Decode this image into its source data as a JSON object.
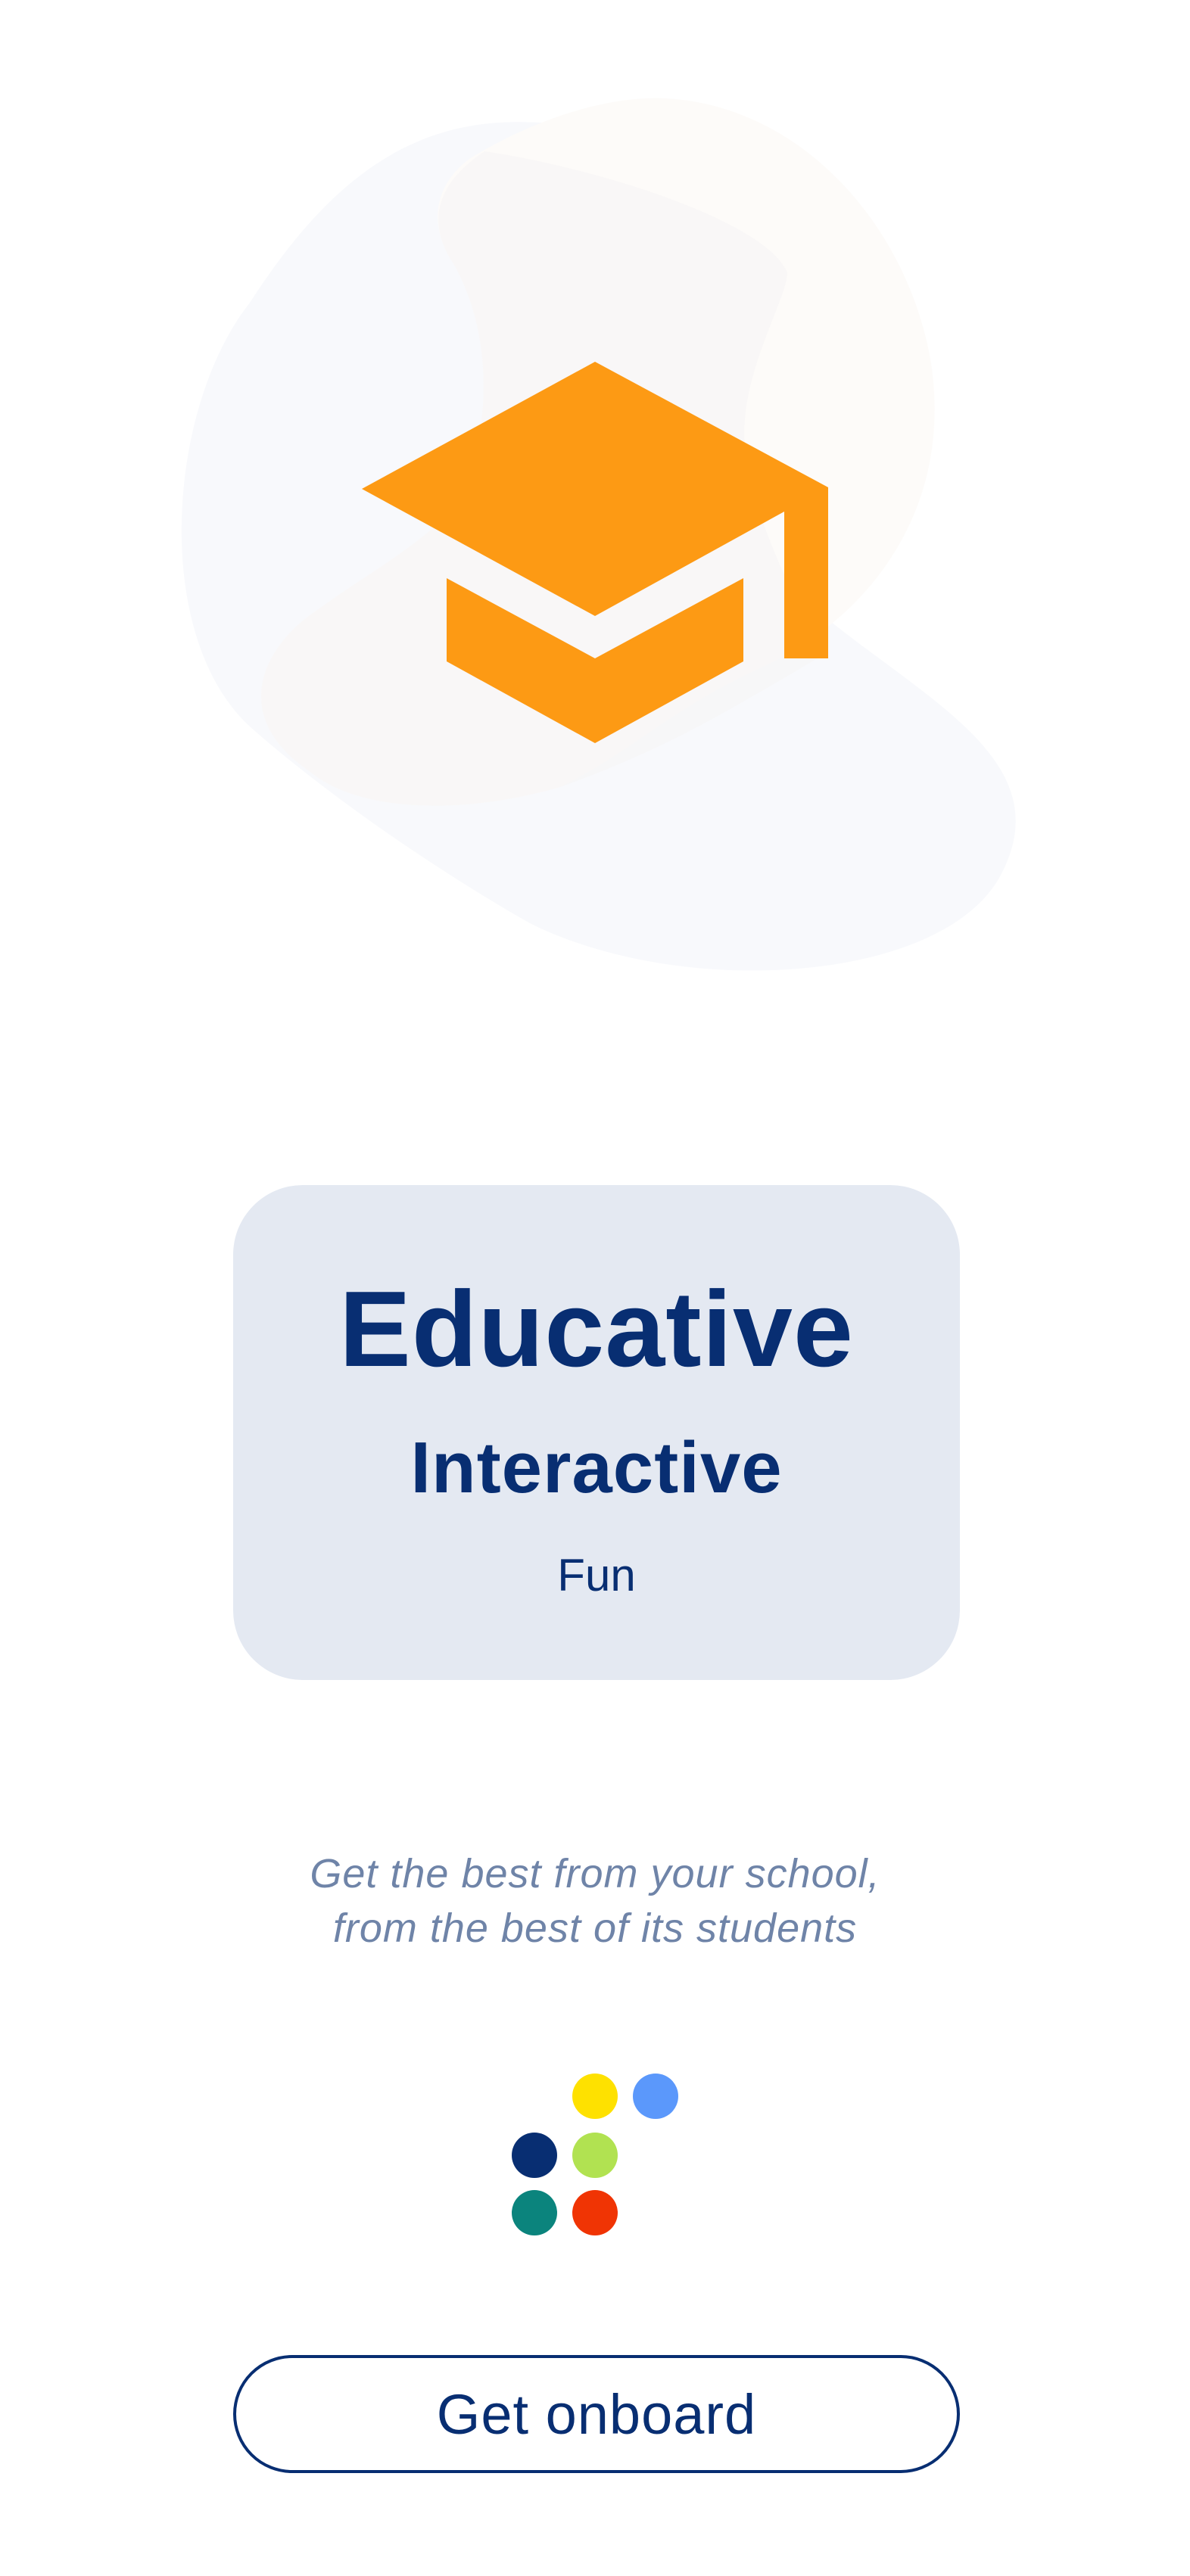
{
  "hero": {
    "icon": "graduation-cap-icon",
    "icon_color": "#fd9a14"
  },
  "card": {
    "title": "Educative",
    "subtitle": "Interactive",
    "caption": "Fun",
    "background": "#e4e9f2",
    "text_color": "#082e72"
  },
  "tagline": {
    "line1": "Get the best from your school,",
    "line2": "from the best of its students",
    "color": "#6f84a8"
  },
  "logo": {
    "icon": "colored-dots-logo",
    "colors": [
      "#fee100",
      "#5b98fb",
      "#082e72",
      "#b1e251",
      "#0b847d",
      "#f03404"
    ]
  },
  "cta": {
    "label": "Get onboard"
  }
}
